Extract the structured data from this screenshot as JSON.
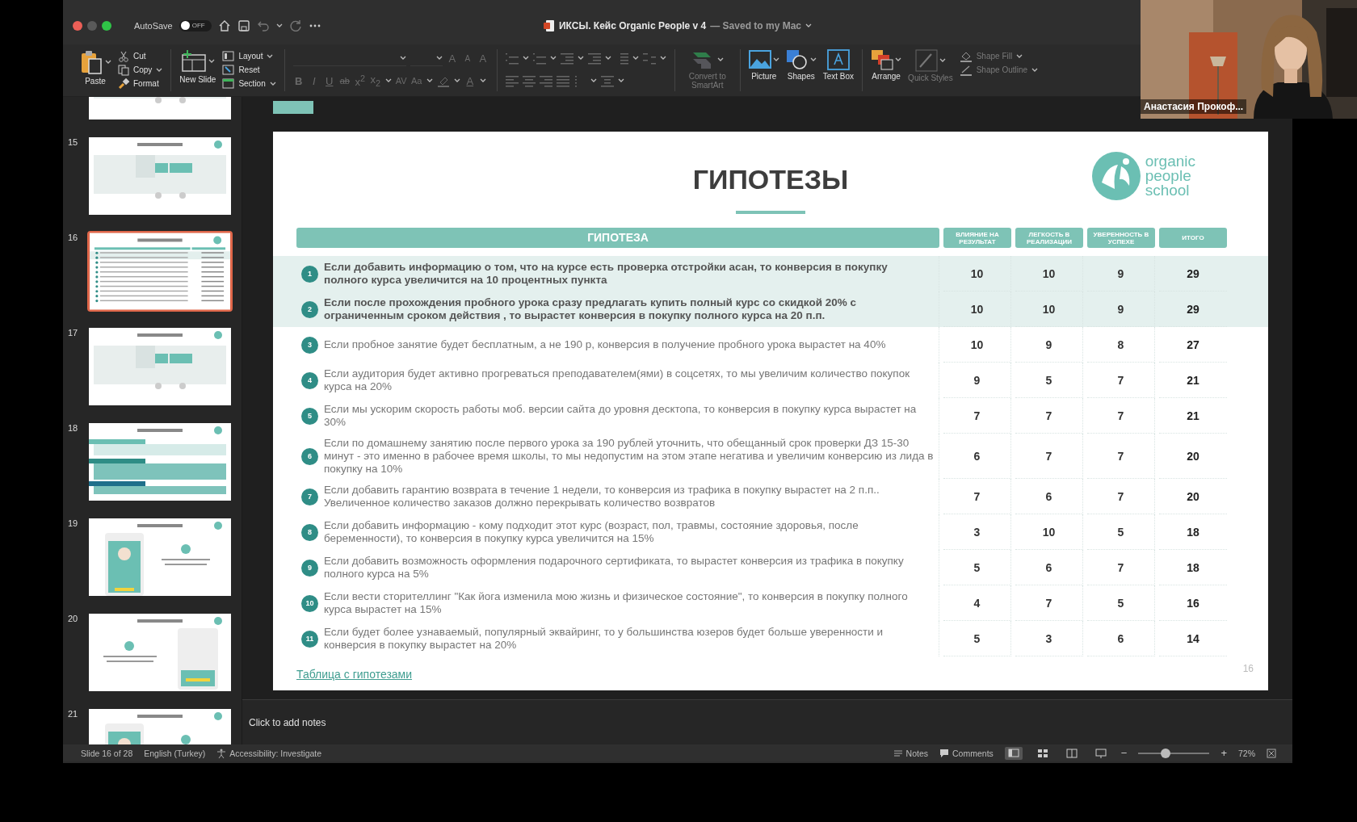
{
  "window": {
    "title": "ИКСЫ. Кейс Organic People v 4",
    "save_status": "— Saved to my Mac"
  },
  "titlebar": {
    "autosave_label": "AutoSave",
    "autosave": {
      "on": false,
      "label": "OFF"
    }
  },
  "ribbon": {
    "groups": [
      {
        "kind": "buttons",
        "items": [
          {
            "kind": "large",
            "label": "Paste",
            "caret": true,
            "disabled": false
          },
          {
            "kind": "small",
            "label": "Cut",
            "caret": false,
            "disabled": false
          },
          {
            "kind": "small",
            "label": "Copy",
            "caret": true,
            "disabled": false
          },
          {
            "kind": "small",
            "label": "Format",
            "caret": false,
            "disabled": false
          }
        ]
      },
      {
        "kind": "buttons",
        "items": [
          {
            "kind": "large",
            "label": "New Slide",
            "caret": true,
            "disabled": false
          },
          {
            "kind": "small",
            "label": "Layout",
            "caret": true,
            "disabled": false
          },
          {
            "kind": "small",
            "label": "Reset",
            "caret": false,
            "disabled": false
          },
          {
            "kind": "small",
            "label": "Section",
            "caret": true,
            "disabled": false
          }
        ]
      },
      {
        "kind": "font",
        "disabled": true,
        "top_buttons": [
          "A",
          "A",
          "A"
        ],
        "bottom_buttons": [
          "B",
          "I",
          "U",
          "ab",
          "x$^{2}$",
          "x$_{2}$",
          "AV",
          "Aa"
        ],
        "font_color": "A"
      },
      {
        "kind": "paragraph",
        "disabled": true
      },
      {
        "kind": "buttons",
        "items": [
          {
            "kind": "large",
            "label": "Convert to SmartArt",
            "caret": true,
            "disabled": true
          }
        ]
      },
      {
        "kind": "buttons",
        "items": [
          {
            "kind": "large",
            "label": "Picture",
            "caret": true,
            "disabled": false
          },
          {
            "kind": "large",
            "label": "Shapes",
            "caret": true,
            "disabled": false
          },
          {
            "kind": "large",
            "label": "Text Box",
            "caret": false,
            "disabled": false
          }
        ]
      },
      {
        "kind": "buttons",
        "items": [
          {
            "kind": "large",
            "label": "Arrange",
            "caret": true,
            "disabled": false
          },
          {
            "kind": "large",
            "label": "Quick Styles",
            "caret": true,
            "disabled": true
          },
          {
            "kind": "small",
            "label": "Shape Fill",
            "caret": true,
            "disabled": true
          },
          {
            "kind": "small",
            "label": "Shape Outline",
            "caret": true,
            "disabled": true
          }
        ]
      }
    ]
  },
  "slide_panel": {
    "thumbnails": [
      {
        "kind": "diagram",
        "selected": false
      },
      {
        "number": "15",
        "kind": "diagram",
        "selected": false
      },
      {
        "number": "16",
        "kind": "table",
        "selected": true
      },
      {
        "number": "17",
        "kind": "diagram",
        "selected": false
      },
      {
        "number": "18",
        "kind": "cards",
        "selected": false
      },
      {
        "number": "19",
        "kind": "phone_left",
        "selected": false
      },
      {
        "number": "20",
        "kind": "phone_right",
        "selected": false
      },
      {
        "number": "21",
        "kind": "phone_left",
        "selected": false
      }
    ]
  },
  "slide": {
    "title": "ГИПОТЕЗЫ",
    "logo": [
      "organic",
      "people",
      "school"
    ],
    "table": {
      "columns": [
        "ГИПОТЕЗА",
        "ВЛИЯНИЕ НА РЕЗУЛЬТАТ",
        "ЛЕГКОСТЬ В РЕАЛИЗАЦИИ",
        "УВЕРЕННОСТЬ В УСПЕХЕ",
        "ИТОГО"
      ],
      "rows": [
        {
          "number": "1",
          "text": "Если добавить информацию о том, что на курсе есть проверка отстройки асан, то конверсия в покупку полного курса увеличится на 10 процентных пункта",
          "scores": [
            "10",
            "10",
            "9"
          ],
          "total": "29",
          "highlighted": true
        },
        {
          "number": "2",
          "text": "Если после прохождения пробного урока сразу предлагать купить полный курс со скидкой 20% с ограниченным сроком действия , то вырастет конверсия в покупку полного курса на 20 п.п.",
          "scores": [
            "10",
            "10",
            "9"
          ],
          "total": "29",
          "highlighted": true
        },
        {
          "number": "3",
          "text": "Если пробное занятие будет бесплатным, а не 190 р, конверсия в получение пробного урока вырастет на 40%",
          "scores": [
            "10",
            "9",
            "8"
          ],
          "total": "27",
          "highlighted": false
        },
        {
          "number": "4",
          "text": "Если аудитория будет активно прогреваться преподавателем(ями) в соцсетях, то мы увеличим количество покупок курса на 20%",
          "scores": [
            "9",
            "5",
            "7"
          ],
          "total": "21",
          "highlighted": false
        },
        {
          "number": "5",
          "text": "Если мы ускорим скорость работы моб. версии сайта до уровня десктопа, то конверсия в покупку курса  вырастет на 30%",
          "scores": [
            "7",
            "7",
            "7"
          ],
          "total": "21",
          "highlighted": false
        },
        {
          "number": "6",
          "text": "Если по домашнему занятию после первого урока за 190 рублей уточнить, что обещанный срок проверки ДЗ 15-30 минут - это именно в рабочее время школы, то мы недопустим на этом этапе негатива и увеличим конверсию из лида в покупку на 10%",
          "scores": [
            "6",
            "7",
            "7"
          ],
          "total": "20",
          "highlighted": false
        },
        {
          "number": "7",
          "text": "Если добавить гарантию возврата в течение 1 недели, то конверсия из трафика в покупку вырастет на 2 п.п.. Увеличенное количество заказов должно перекрывать количество возвратов",
          "scores": [
            "7",
            "6",
            "7"
          ],
          "total": "20",
          "highlighted": false
        },
        {
          "number": "8",
          "text": "Если добавить информацию - кому подходит этот курс (возраст, пол, травмы, состояние здоровья, после беременности), то конверсия в покупку курса увеличится на 15%",
          "scores": [
            "3",
            "10",
            "5"
          ],
          "total": "18",
          "highlighted": false
        },
        {
          "number": "9",
          "text": "Если добавить возможность оформления подарочного сертификата, то вырастет конверсия из трафика в покупку полного курса на 5%",
          "scores": [
            "5",
            "6",
            "7"
          ],
          "total": "18",
          "highlighted": false
        },
        {
          "number": "10",
          "text": "Если вести сторителлинг \"Как йога изменила мою жизнь и физическое состояние\", то конверсия в покупку полного курса вырастет на 15%",
          "scores": [
            "4",
            "7",
            "5"
          ],
          "total": "16",
          "highlighted": false
        },
        {
          "number": "11",
          "text": "Если будет более узнаваемый, популярный эквайринг, то у большинства юзеров будет больше уверенности и конверсия в покупку вырастет на 20%",
          "scores": [
            "5",
            "3",
            "6"
          ],
          "total": "14",
          "highlighted": false
        }
      ]
    },
    "link": "Таблица с гипотезами",
    "page_number": "16"
  },
  "notes": {
    "placeholder": "Click to add notes"
  },
  "status_bar": {
    "slide": "Slide 16 of 28",
    "language": "English (Turkey)",
    "accessibility": "Accessibility: Investigate",
    "notes": "Notes",
    "comments": "Comments",
    "views": [
      {
        "selected": true
      },
      {
        "selected": false
      },
      {
        "selected": false
      },
      {
        "selected": false
      }
    ],
    "zoom": {
      "minus": "−",
      "plus": "+",
      "level": 0.38,
      "reading": "72%"
    }
  },
  "video_tile": {
    "name": "Анастасия Прокоф..."
  }
}
